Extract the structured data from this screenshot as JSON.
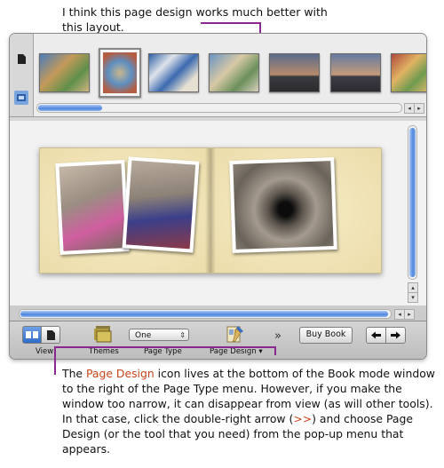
{
  "captions": {
    "top": "I think this page design works much better with this layout.",
    "bottom_pre": "The ",
    "bottom_hl": "Page Design",
    "bottom_mid": " icon lives at the bottom of the Book mode window to the right of the Page Type menu. However, if you make the window too narrow, it can disappear from view (as will other tools). In that case, click the double-right arrow (",
    "bottom_hl2": ">>",
    "bottom_post": ") and choose Page Design (or the tool that you need) from the pop-up menu that appears."
  },
  "toolbar": {
    "view_label": "View",
    "themes_label": "Themes",
    "page_type_value": "One",
    "page_type_label": "Page Type",
    "page_design_label": "Page Design ▾",
    "overflow_arrow": "»",
    "buy_book_label": "Buy Book"
  },
  "colors": {
    "callout": "#8a2790",
    "highlight": "#c8431d",
    "scroll_accent": "#4f86dc"
  },
  "icons": {
    "single-page-icon": "page",
    "page-design-icon": "brush",
    "themes-icon": "folder-stack",
    "prev-icon": "arrow-left",
    "next-icon": "arrow-right"
  }
}
